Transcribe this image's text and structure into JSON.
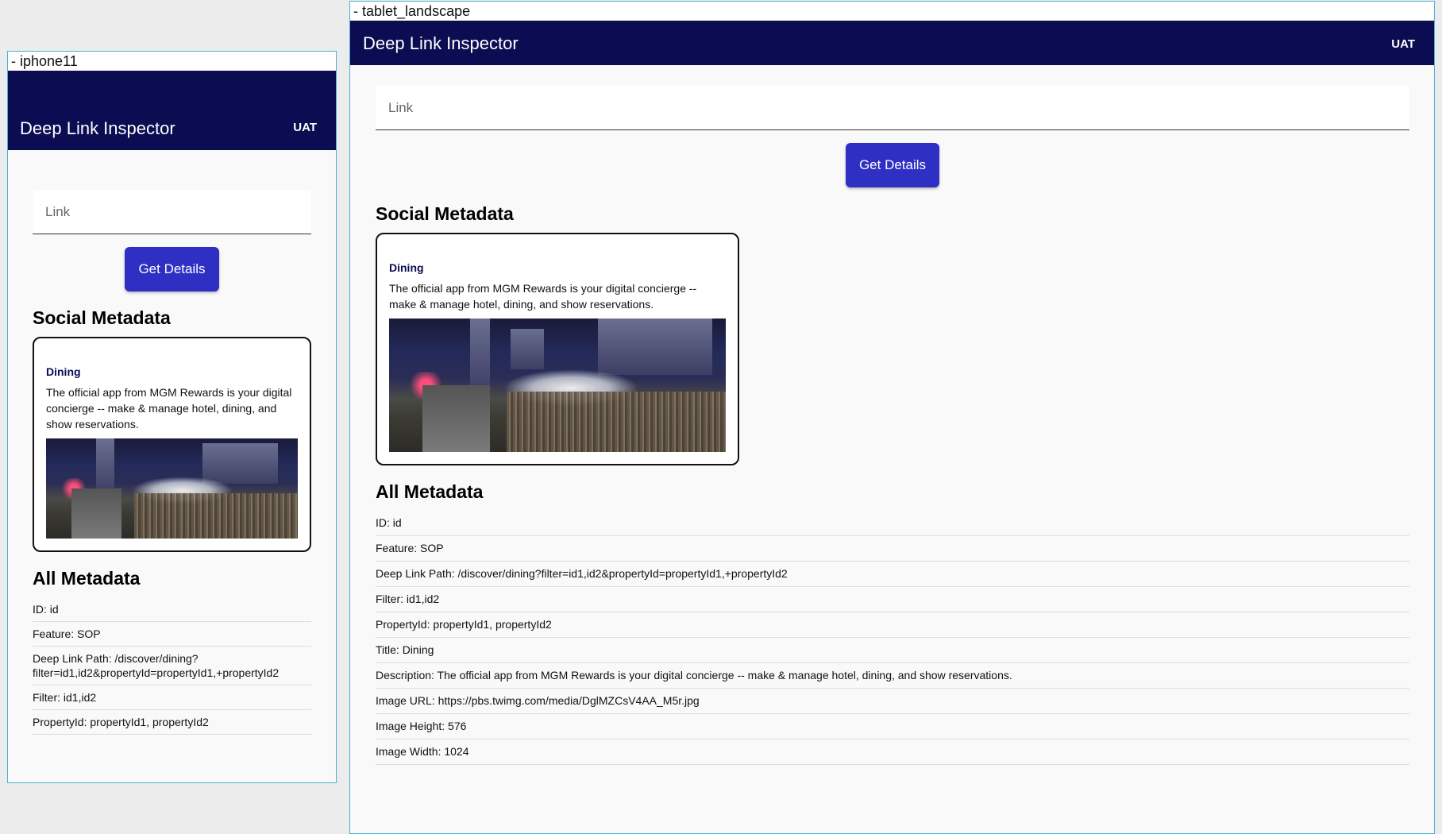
{
  "devices": {
    "phone": {
      "label": "- iphone11"
    },
    "tablet": {
      "label": "- tablet_landscape"
    }
  },
  "header": {
    "title": "Deep Link Inspector",
    "env": "UAT"
  },
  "form": {
    "link_placeholder": "Link",
    "button_label": "Get Details"
  },
  "social": {
    "heading": "Social Metadata",
    "card": {
      "title": "Dining",
      "description": "The official app from MGM Rewards is your digital concierge -- make & manage hotel, dining, and show reservations.",
      "image_alt": "Las Vegas Strip at night with Bellagio fountains and race track grandstand"
    }
  },
  "all_metadata": {
    "heading": "All Metadata",
    "items": [
      {
        "label": "ID: id"
      },
      {
        "label": "Feature: SOP"
      },
      {
        "label": "Deep Link Path: /discover/dining?filter=id1,id2&propertyId=propertyId1,+propertyId2"
      },
      {
        "label": "Filter: id1,id2"
      },
      {
        "label": "PropertyId: propertyId1, propertyId2"
      },
      {
        "label": "Title: Dining"
      },
      {
        "label": "Description: The official app from MGM Rewards is your digital concierge -- make & manage hotel, dining, and show reservations."
      },
      {
        "label": "Image URL: https://pbs.twimg.com/media/DglMZCsV4AA_M5r.jpg"
      },
      {
        "label": "Image Height: 576"
      },
      {
        "label": "Image Width: 1024"
      }
    ]
  },
  "colors": {
    "header_bg": "#0b0c52",
    "button_bg": "#2f2fc3",
    "device_border": "#4ab0d8"
  }
}
